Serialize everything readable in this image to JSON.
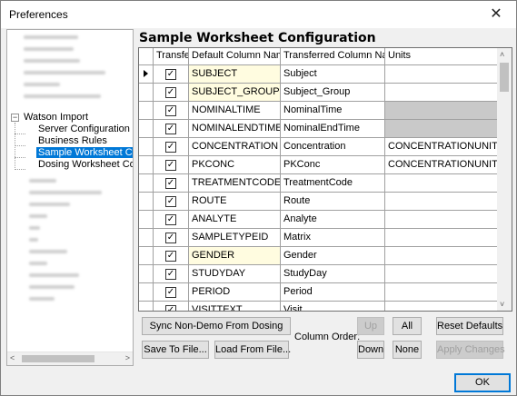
{
  "window": {
    "title": "Preferences",
    "close_glyph": "✕"
  },
  "tree": {
    "parent": "Watson Import",
    "children": [
      "Server Configuration",
      "Business Rules",
      "Sample Worksheet Conf",
      "Dosing Worksheet Confi"
    ],
    "expander": "−",
    "scroll_left": "<",
    "scroll_right": ">"
  },
  "panel": {
    "title": "Sample Worksheet Configuration"
  },
  "grid": {
    "columns": [
      "Transfer",
      "Default Column Name",
      "Transferred Column Name",
      "Units"
    ],
    "rows": [
      {
        "transfer": true,
        "default": "SUBJECT",
        "transferred": "Subject",
        "units": "",
        "current": true,
        "highlight": true,
        "units_gray": false
      },
      {
        "transfer": true,
        "default": "SUBJECT_GROUP",
        "transferred": "Subject_Group",
        "units": "",
        "current": false,
        "highlight": true,
        "units_gray": false
      },
      {
        "transfer": true,
        "default": "NOMINALTIME",
        "transferred": "NominalTime",
        "units": "",
        "current": false,
        "highlight": false,
        "units_gray": true
      },
      {
        "transfer": true,
        "default": "NOMINALENDTIME",
        "transferred": "NominalEndTime",
        "units": "",
        "current": false,
        "highlight": false,
        "units_gray": true
      },
      {
        "transfer": true,
        "default": "CONCENTRATION",
        "transferred": "Concentration",
        "units": "CONCENTRATIONUNITS",
        "current": false,
        "highlight": false,
        "units_gray": false
      },
      {
        "transfer": true,
        "default": "PKCONC",
        "transferred": "PKConc",
        "units": "CONCENTRATIONUNITS",
        "current": false,
        "highlight": false,
        "units_gray": false
      },
      {
        "transfer": true,
        "default": "TREATMENTCODE",
        "transferred": "TreatmentCode",
        "units": "",
        "current": false,
        "highlight": false,
        "units_gray": false
      },
      {
        "transfer": true,
        "default": "ROUTE",
        "transferred": "Route",
        "units": "",
        "current": false,
        "highlight": false,
        "units_gray": false
      },
      {
        "transfer": true,
        "default": "ANALYTE",
        "transferred": "Analyte",
        "units": "",
        "current": false,
        "highlight": false,
        "units_gray": false
      },
      {
        "transfer": true,
        "default": "SAMPLETYPEID",
        "transferred": "Matrix",
        "units": "",
        "current": false,
        "highlight": false,
        "units_gray": false
      },
      {
        "transfer": true,
        "default": "GENDER",
        "transferred": "Gender",
        "units": "",
        "current": false,
        "highlight": true,
        "units_gray": false
      },
      {
        "transfer": true,
        "default": "STUDYDAY",
        "transferred": "StudyDay",
        "units": "",
        "current": false,
        "highlight": false,
        "units_gray": false
      },
      {
        "transfer": true,
        "default": "PERIOD",
        "transferred": "Period",
        "units": "",
        "current": false,
        "highlight": false,
        "units_gray": false
      },
      {
        "transfer": true,
        "default": "VISITTEXT",
        "transferred": "Visit",
        "units": "",
        "current": false,
        "highlight": false,
        "units_gray": false
      }
    ],
    "scroll_up": "˄",
    "scroll_down": "˅"
  },
  "buttons": {
    "sync": "Sync Non-Demo From Dosing",
    "save": "Save To File...",
    "load": "Load From File...",
    "column_order": "Column Order:",
    "up": "Up",
    "down": "Down",
    "all": "All",
    "none": "None",
    "reset": "Reset Defaults",
    "apply": "Apply Changes",
    "ok": "OK"
  }
}
